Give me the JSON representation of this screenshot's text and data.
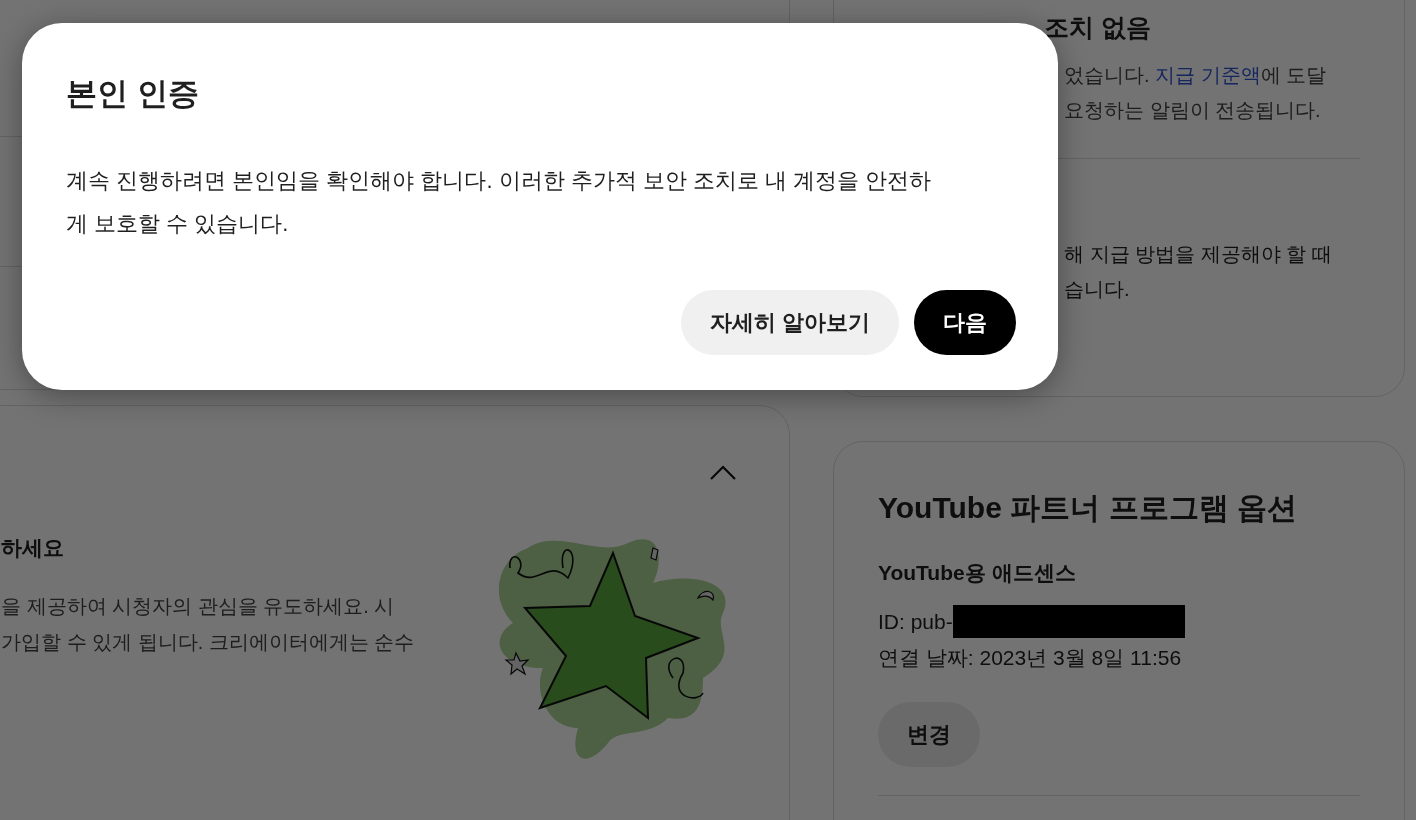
{
  "background": {
    "status_card": {
      "heading": "조치 없음",
      "lines": [
        {
          "before": "었습니다. ",
          "link": "지급 기준액",
          "after": "에 도달"
        },
        {
          "before": "요청하는 알림이 전송됩니다."
        }
      ],
      "lines_2": [
        "해 지급 방법을 제공해야 할 때",
        "습니다."
      ]
    },
    "promo_card": {
      "expanded": true,
      "heading": "하세요",
      "body": [
        "을 제공하여 시청자의 관심을 유도하세요. 시",
        "가입할 수 있게 됩니다. 크리에이터에게는 순수"
      ]
    },
    "partner_card": {
      "title": "YouTube 파트너 프로그램 옵션",
      "subtitle": "YouTube용 애드센스",
      "id_label": "ID: pub-",
      "redacted": true,
      "connected": "연결 날짜: 2023년 3월 8일 11:56",
      "button": "변경"
    }
  },
  "dialog": {
    "title": "본인 인증",
    "body": "계속 진행하려면 본인임을 확인해야 합니다. 이러한 추가적 보안 조치로 내 계정을 안전하게 보호할 수 있습니다.",
    "buttons": [
      {
        "label": "자세히 알아보기",
        "kind": "secondary"
      },
      {
        "label": "다음",
        "kind": "primary"
      }
    ]
  }
}
